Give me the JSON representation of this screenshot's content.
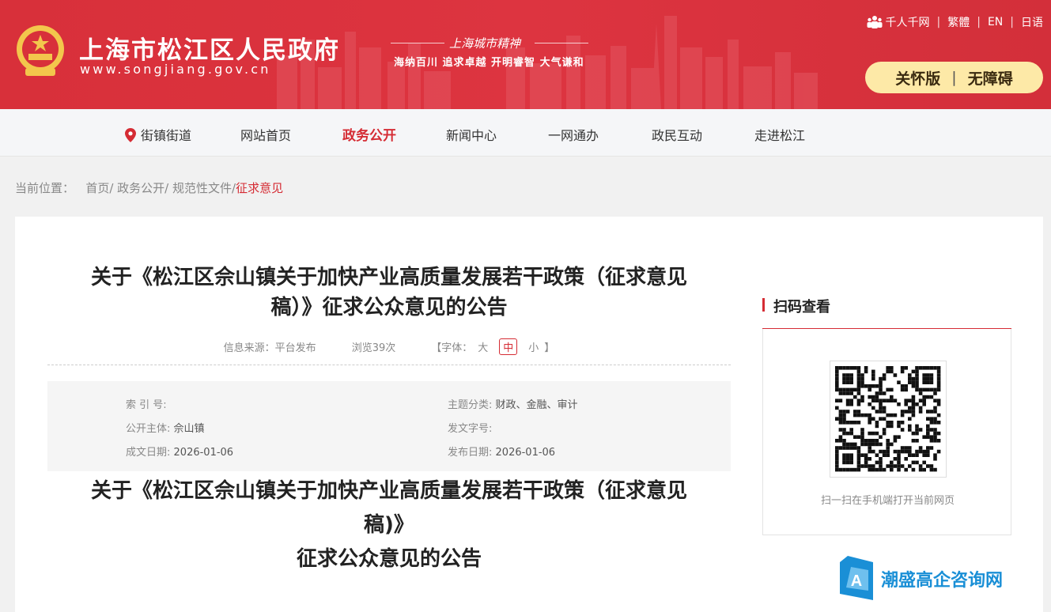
{
  "header": {
    "site_name": "上海市松江区人民政府",
    "site_url": "www.songjiang.gov.cn",
    "spirit_title": "上海城市精神",
    "spirit_sub": "海纳百川  追求卓越  开明睿智  大气谦和",
    "links": {
      "thousand": "千人千网",
      "traditional": "繁體",
      "english": "EN",
      "japanese": "日语"
    },
    "care_mode": "关怀版",
    "accessible_mode": "无障碍",
    "colors": {
      "brand_red": "#d8303a",
      "pill": "#fde9a7"
    }
  },
  "nav": {
    "items": [
      {
        "label": "街镇街道",
        "icon": "location-pin-icon"
      },
      {
        "label": "网站首页"
      },
      {
        "label": "政务公开",
        "active": true
      },
      {
        "label": "新闻中心"
      },
      {
        "label": "一网通办"
      },
      {
        "label": "政民互动"
      },
      {
        "label": "走进松江"
      }
    ]
  },
  "breadcrumb": {
    "prefix": "当前位置：",
    "items": [
      "首页/",
      "政务公开/",
      "规范性文件/"
    ],
    "current": "征求意见"
  },
  "article": {
    "title_line1": "关于《松江区佘山镇关于加快产业高质量发展若干政策（征求意见",
    "title_line2": "稿）》征求公众意见的公告",
    "source": "信息来源：平台发布",
    "views": "浏览39次",
    "font_label_open": "【字体：",
    "font_large": "大",
    "font_medium": "中",
    "font_small": "小",
    "font_label_close": "】",
    "info": {
      "index_label": "索 引 号:",
      "index_value": "",
      "category_label": "主题分类:",
      "category_value": "财政、金融、审计",
      "publisher_label": "公开主体:",
      "publisher_value": "佘山镇",
      "docno_label": "发文字号:",
      "docno_value": "",
      "created_label": "成文日期:",
      "created_value": "2026-01-06",
      "published_label": "发布日期:",
      "published_value": "2026-01-06"
    },
    "body_title_line1": "关于《松江区佘山镇关于加快产业高质量发展若干政策（征求意见",
    "body_title_line2": "稿)》",
    "body_title_line3": "征求公众意见的公告"
  },
  "sidebar": {
    "qr_title": "扫码查看",
    "qr_caption": "扫一扫在手机端打开当前网页"
  },
  "watermark": {
    "text": "潮盛高企咨询网",
    "color": "#1a8fd6"
  }
}
